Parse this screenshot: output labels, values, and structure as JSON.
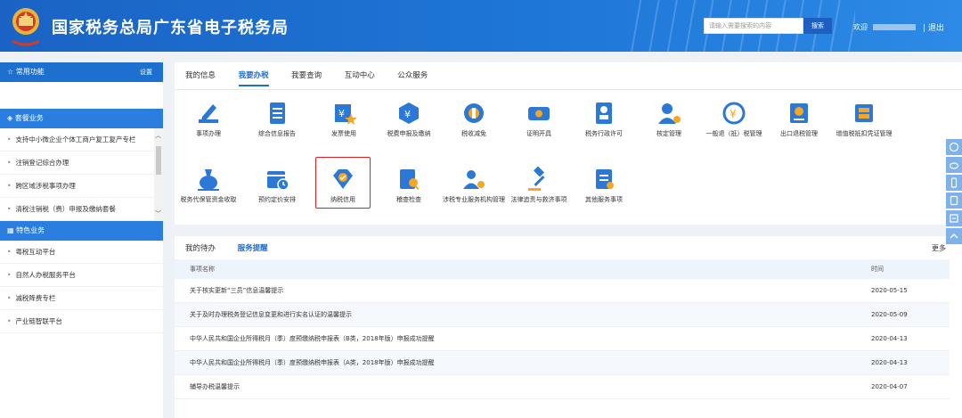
{
  "header": {
    "title": "国家税务总局广东省电子税务局",
    "search_placeholder": "请输入需要搜索的内容",
    "search_button": "搜索",
    "welcome": "欢迎",
    "logout": "退出"
  },
  "sidebar": {
    "common_label": "常用功能",
    "setting_label": "设置",
    "package_label": "套餐业务",
    "package_items": [
      "支持中小微企业个体工商户复工复产专栏",
      "注销登记综合办理",
      "跨区域涉税事项办理",
      "清税注销税（费）申报及缴纳套餐"
    ],
    "feature_label": "特色业务",
    "feature_items": [
      "粤税互动平台",
      "自然人办税服务平台",
      "减税降费专栏",
      "产业链智联平台"
    ]
  },
  "tabs": [
    "我的信息",
    "我要办税",
    "我要查询",
    "互动中心",
    "公众服务"
  ],
  "active_tab": "我要办税",
  "services_row1": [
    {
      "label": "事项办理",
      "icon": "pen-icon"
    },
    {
      "label": "综合信息报告",
      "icon": "document-icon"
    },
    {
      "label": "发票使用",
      "icon": "invoice-icon"
    },
    {
      "label": "税费申报及缴纳",
      "icon": "tax-declare-icon"
    },
    {
      "label": "税收减免",
      "icon": "tax-relief-icon"
    },
    {
      "label": "证明开具",
      "icon": "certificate-icon"
    },
    {
      "label": "税务行政许可",
      "icon": "admin-permit-icon"
    },
    {
      "label": "核定管理",
      "icon": "verify-manage-icon"
    },
    {
      "label": "一般退（抵）税管理",
      "icon": "refund-icon"
    },
    {
      "label": "出口退税管理",
      "icon": "export-refund-icon"
    },
    {
      "label": "增值税抵扣凭证管理",
      "icon": "vat-deduction-icon"
    }
  ],
  "services_row2": [
    {
      "label": "税务代保管资金收取",
      "icon": "money-bag-icon"
    },
    {
      "label": "预约定价安排",
      "icon": "calendar-icon"
    },
    {
      "label": "纳税信用",
      "icon": "credit-diamond-icon"
    },
    {
      "label": "稽查检查",
      "icon": "inspection-icon"
    },
    {
      "label": "涉税专业服务机构管理",
      "icon": "agency-icon"
    },
    {
      "label": "法律追责与救济事项",
      "icon": "gavel-icon"
    },
    {
      "label": "其他服务事项",
      "icon": "other-services-icon"
    }
  ],
  "highlighted_service": "纳税信用",
  "bottom_tabs": [
    "我的待办",
    "服务提醒"
  ],
  "active_bottom_tab": "服务提醒",
  "more_label": "更多",
  "table": {
    "headers": [
      "事项名称",
      "时间"
    ],
    "rows": [
      {
        "name": "关于核实更新“三员”信息温馨提示",
        "date": "2020-05-15"
      },
      {
        "name": "关于及时办理税务登记信息变更和进行实名认证的温馨提示",
        "date": "2020-05-09"
      },
      {
        "name": "中华人民共和国企业所得税月（季）度预缴纳税申报表（B类，2018年版）申报成功提醒",
        "date": "2020-04-13"
      },
      {
        "name": "中华人民共和国企业所得税月（季）度预缴纳税申报表（A类，2018年版）申报成功提醒",
        "date": "2020-04-13"
      },
      {
        "name": "辅导办税温馨提示",
        "date": "2020-04-07"
      }
    ]
  },
  "colors": {
    "brand_blue": "#1d6fd0",
    "highlight_red": "#e02020",
    "icon_blue": "#2b78d6",
    "icon_orange": "#f5a623"
  },
  "right_tools": [
    "customer-service-icon",
    "weibo-icon",
    "mobile-icon",
    "tablet-icon",
    "feedback-icon",
    "back-to-top-icon"
  ]
}
